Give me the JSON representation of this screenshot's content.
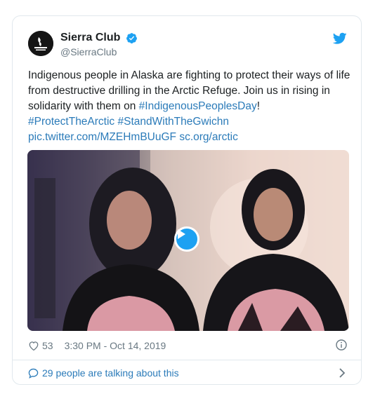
{
  "account": {
    "display_name": "Sierra Club",
    "handle": "@SierraClub"
  },
  "tweet": {
    "text_plain_1": "Indigenous people in Alaska are fighting to protect their ways of life from destructive drilling in the Arctic Refuge. Join us in rising in solidarity with them on ",
    "hashtag_1": "#IndigenousPeoplesDay",
    "text_plain_2": "!",
    "hashtag_2": "#ProtectTheArctic",
    "hashtag_3": "#StandWithTheGwichn",
    "link_1": "pic.twitter.com/MZEHmBUuGF",
    "link_2": "sc.org/arctic"
  },
  "meta": {
    "likes": "53",
    "timestamp": "3:30 PM - Oct 14, 2019"
  },
  "footer": {
    "talking": "29 people are talking about this"
  },
  "icons": {
    "verified": "verified-badge-icon",
    "bird": "twitter-bird-icon",
    "heart": "heart-icon",
    "info": "info-icon",
    "bubble": "comment-bubble-icon",
    "chevron": "chevron-right-icon",
    "play": "play-icon"
  },
  "colors": {
    "link": "#2b7bb9",
    "twitter_blue": "#1da1f2",
    "muted": "#697882"
  }
}
